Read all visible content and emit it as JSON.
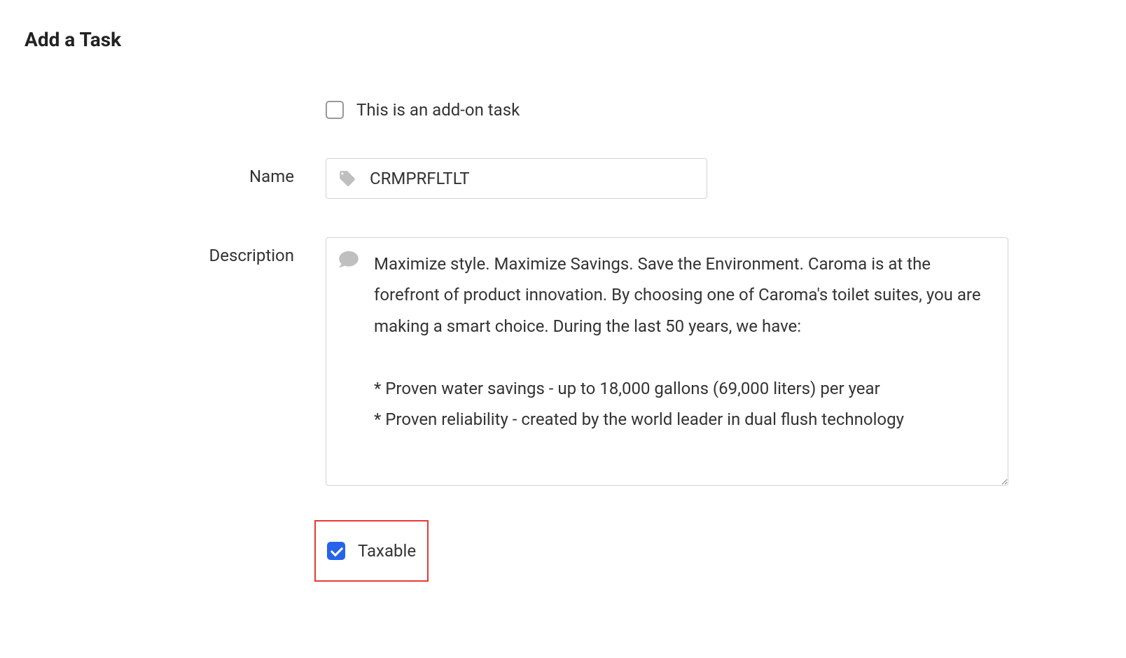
{
  "page": {
    "title": "Add a Task"
  },
  "form": {
    "addon": {
      "label": "This is an add-on task",
      "checked": false
    },
    "name": {
      "label": "Name",
      "value": "CRMPRFLTLT",
      "icon_name": "tag-icon"
    },
    "description": {
      "label": "Description",
      "value": "Maximize style. Maximize Savings. Save the Environment. Caroma is at the forefront of product innovation. By choosing one of Caroma's toilet suites, you are making a smart choice. During the last 50 years, we have:\n\n* Proven water savings - up to 18,000 gallons (69,000 liters) per year\n* Proven reliability - created by the world leader in dual flush technology",
      "icon_name": "comment-icon"
    },
    "taxable": {
      "label": "Taxable",
      "checked": true
    }
  }
}
